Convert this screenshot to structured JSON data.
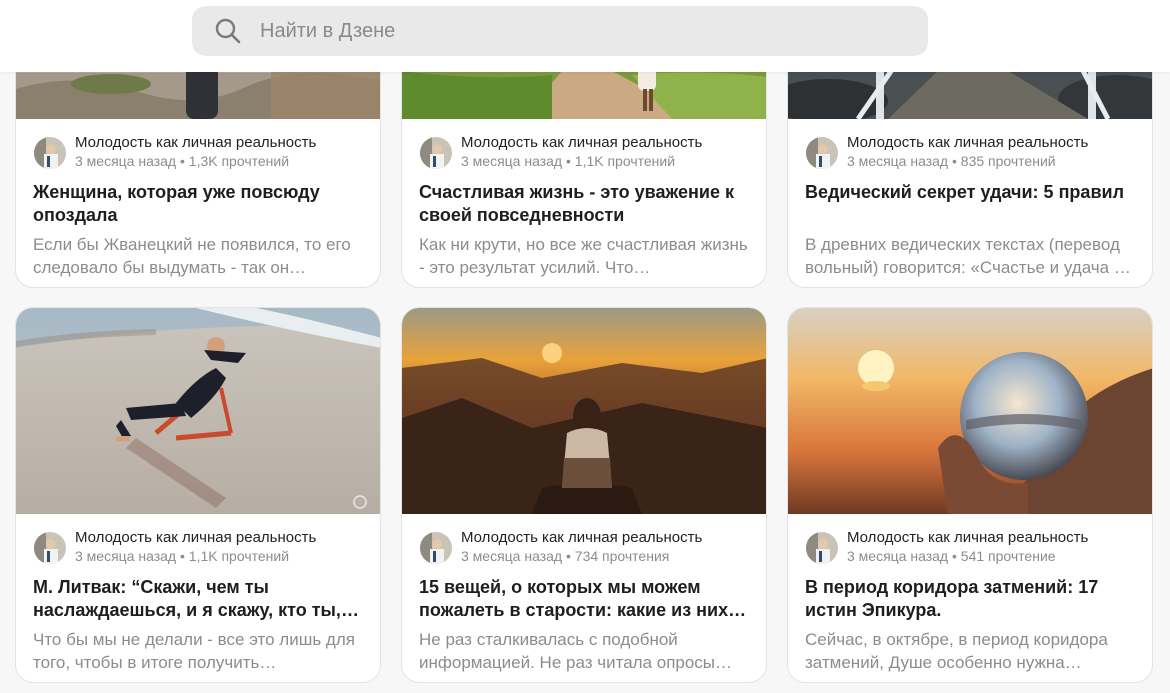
{
  "search": {
    "placeholder": "Найти в Дзене"
  },
  "cards": [
    {
      "channel": "Молодость как личная реальность",
      "stats": "3 месяца назад • 1,3K прочтений",
      "title": "Женщина, которая уже повсюду опоздала",
      "desc": "Если бы Жванецкий не появился, то его следовало бы выдумать - так он…"
    },
    {
      "channel": "Молодость как личная реальность",
      "stats": "3 месяца назад • 1,1K прочтений",
      "title": "Счастливая жизнь - это уважение к своей повседневности",
      "desc": "Как ни крути, но все же счастливая жизнь - это результат усилий. Что…"
    },
    {
      "channel": "Молодость как личная реальность",
      "stats": "3 месяца назад • 835 прочтений",
      "title": "Ведический секрет удачи: 5 правил",
      "desc": "В древних ведических текстах (перевод вольный) говорится: «Счастье и удача – это то, что у человека в руках по…"
    },
    {
      "channel": "Молодость как личная реальность",
      "stats": "3 месяца назад • 1,1K прочтений",
      "title": "М. Литвак: “Скажи, чем ты наслаждаешься, и я скажу, кто ты,” …",
      "desc": "Что бы мы не делали - все это лишь для того, чтобы в итоге получить…"
    },
    {
      "channel": "Молодость как личная реальность",
      "stats": "3 месяца назад • 734 прочтения",
      "title": "15 вещей, о которых мы можем пожалеть в старости: какие из них…",
      "desc": "Не раз сталкивалась с подобной информацией. Не раз читала опросы…"
    },
    {
      "channel": "Молодость как личная реальность",
      "stats": "3 месяца назад • 541 прочтение",
      "title": "В период коридора затмений: 17 истин Эпикура.",
      "desc": "Сейчас, в октябре, в период коридора затмений, Душе особенно нужна…"
    }
  ],
  "icons": {
    "search": "search-icon",
    "avatar": "channel-avatar"
  }
}
